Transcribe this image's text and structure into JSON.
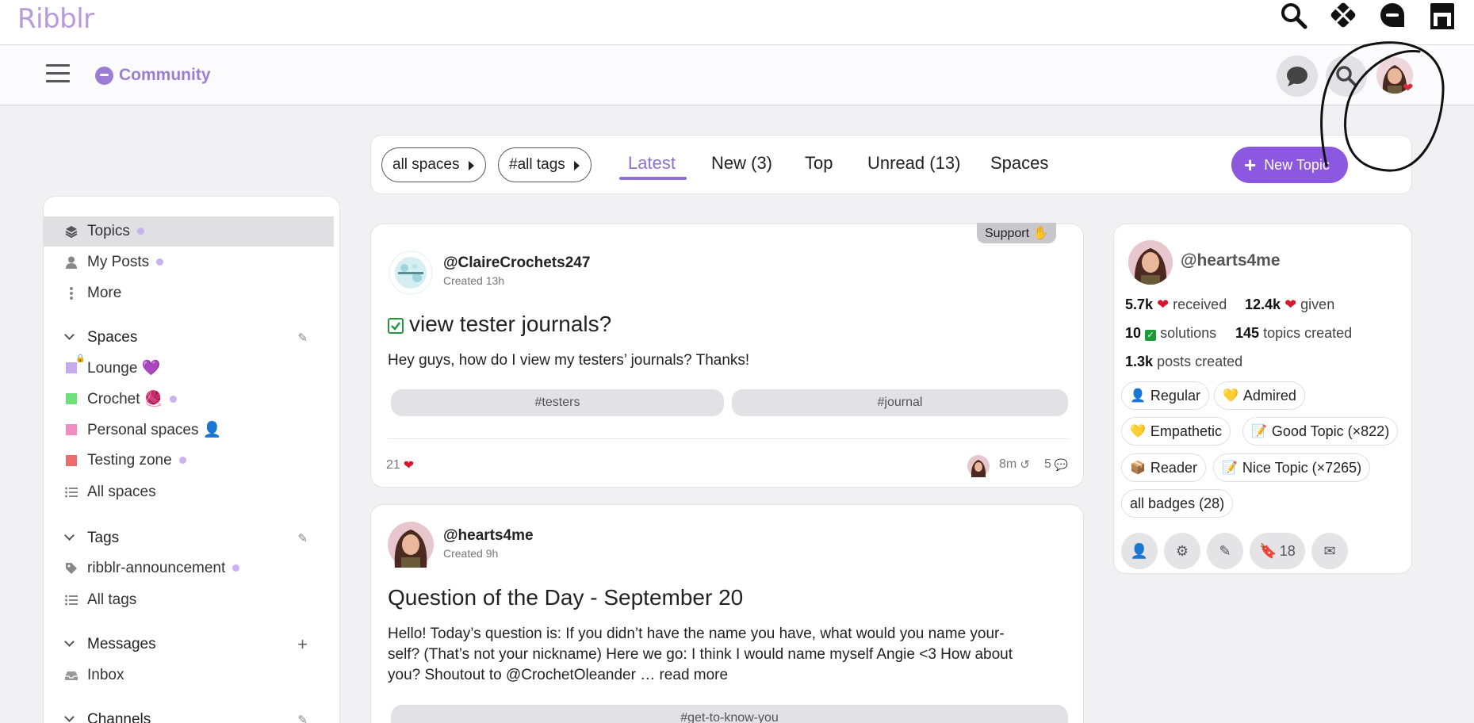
{
  "app": {
    "logo": "Ribblr"
  },
  "top_icons": [
    {
      "name": "search-icon"
    },
    {
      "name": "patterns-icon"
    },
    {
      "name": "community-icon"
    },
    {
      "name": "shop-icon"
    }
  ],
  "community": {
    "title": "Community"
  },
  "filters": {
    "spaces": "all spaces",
    "tags": "#all tags"
  },
  "tabs": [
    {
      "label": "Latest",
      "active": true
    },
    {
      "label": "New (3)"
    },
    {
      "label": "Top"
    },
    {
      "label": "Unread (13)"
    },
    {
      "label": "Spaces"
    }
  ],
  "new_topic": {
    "label": "New Topic"
  },
  "sidebar": {
    "main": [
      {
        "label": "Topics",
        "dot": true
      },
      {
        "label": "My Posts",
        "dot": true
      },
      {
        "label": "More"
      }
    ],
    "spaces_heading": "Spaces",
    "spaces": [
      {
        "label": "Lounge 💜",
        "color": "#c7a9f2"
      },
      {
        "label": "Crochet 🧶",
        "color": "#6ee07a",
        "dot": true
      },
      {
        "label": "Personal spaces 👤",
        "color": "#f28cc0"
      },
      {
        "label": "Testing zone",
        "color": "#ec6b6b",
        "dot": true
      },
      {
        "label": "All spaces"
      }
    ],
    "tags_heading": "Tags",
    "tags": [
      {
        "label": "ribblr-announcement",
        "dot": true
      },
      {
        "label": "All tags"
      }
    ],
    "messages_heading": "Messages",
    "messages": [
      {
        "label": "Inbox"
      }
    ],
    "channels_heading": "Channels"
  },
  "posts": [
    {
      "category": "Support ✋",
      "author": "@ClaireCrochets247",
      "created": "Created 13h",
      "title": "view tester journals?",
      "body": "Hey guys, how do I view my testers’ journals? Thanks!",
      "tags": [
        "#testers",
        "#journal"
      ],
      "likes": "21",
      "last_activity": "8m",
      "replies": "5"
    },
    {
      "author": "@hearts4me",
      "created": "Created 9h",
      "title": "Question of the Day - September 20",
      "body_lines": [
        "Hello! Today’s question is: If you didn’t have the name you have, what would you name your-",
        "self? (That’s not your nickname) Here we go: I think I would name myself Angie <3 How about",
        "you? Shoutout to @CrochetOleander … "
      ],
      "read_more": "read more",
      "tags": [
        "#get-to-know-you"
      ]
    }
  ],
  "profile": {
    "name": "@hearts4me",
    "received_count": "5.7k",
    "received_label": "received",
    "given_count": "12.4k",
    "given_label": "given",
    "solutions_count": "10",
    "solutions_label": "solutions",
    "topics_count": "145",
    "topics_label": "topics created",
    "posts_count": "1.3k",
    "posts_label": "posts created",
    "badges": [
      {
        "label": "Regular",
        "icon": "person-icon"
      },
      {
        "label": "Admired",
        "icon": "yellow-heart-icon"
      },
      {
        "label": "Empathetic",
        "icon": "yellow-heart-icon"
      },
      {
        "label": "Good Topic (×822)",
        "icon": "topic-icon"
      },
      {
        "label": "Reader",
        "icon": "reader-icon"
      },
      {
        "label": "Nice Topic (×7265)",
        "icon": "topic-icon"
      },
      {
        "label": "all badges (28)"
      }
    ],
    "bookmarks": "18"
  },
  "colors": {
    "accent": "#8f6fd1",
    "button": "#8c58e0",
    "heart": "#d7162e"
  }
}
